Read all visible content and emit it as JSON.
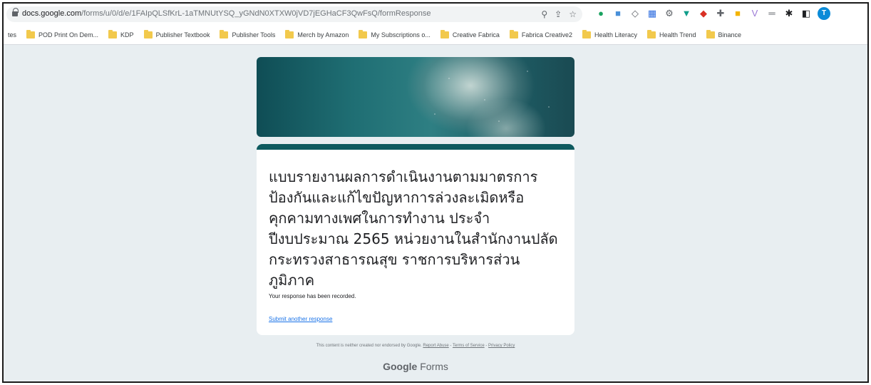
{
  "browser": {
    "url_host": "docs.google.com",
    "url_path": "/forms/u/0/d/e/1FAIpQLSfKrL-1aTMNUtYSQ_yGNdN0XTXW0jVD7jEGHaCF3QwFsQ/formResponse",
    "omnibox_icons": [
      "search-icon",
      "share-icon",
      "star-icon"
    ],
    "extensions": [
      {
        "name": "extension-green-icon",
        "glyph": "●",
        "color": "#1aa260"
      },
      {
        "name": "extension-blue-icon",
        "glyph": "■",
        "color": "#4a90d9"
      },
      {
        "name": "extension-diamond-icon",
        "glyph": "◇",
        "color": "#5f6368"
      },
      {
        "name": "extension-chart-icon",
        "glyph": "▦",
        "color": "#2d6cdf"
      },
      {
        "name": "extension-puzzle-icon",
        "glyph": "⚙",
        "color": "#5f6368"
      },
      {
        "name": "extension-funnel-icon",
        "glyph": "▼",
        "color": "#0f9d8a"
      },
      {
        "name": "extension-colorful-icon",
        "glyph": "◆",
        "color": "#d93025"
      },
      {
        "name": "extension-grid-icon",
        "glyph": "✚",
        "color": "#5f6368"
      },
      {
        "name": "extension-yellow-icon",
        "glyph": "■",
        "color": "#f4b400"
      },
      {
        "name": "extension-v-icon",
        "glyph": "V",
        "color": "#9c7ad6"
      },
      {
        "name": "extension-dash-icon",
        "glyph": "═",
        "color": "#5f6368"
      },
      {
        "name": "extensions-puzzle-icon",
        "glyph": "✱",
        "color": "#202124"
      },
      {
        "name": "side-panel-icon",
        "glyph": "◧",
        "color": "#202124"
      }
    ],
    "avatar_letter": "T"
  },
  "bookmarks": [
    {
      "label": "tes",
      "folder": false
    },
    {
      "label": "POD Print On Dem...",
      "folder": true
    },
    {
      "label": "KDP",
      "folder": true
    },
    {
      "label": "Publisher Textbook",
      "folder": true
    },
    {
      "label": "Publisher Tools",
      "folder": true
    },
    {
      "label": "Merch by Amazon",
      "folder": true
    },
    {
      "label": "My Subscriptions o...",
      "folder": true
    },
    {
      "label": "Creative Fabrica",
      "folder": true
    },
    {
      "label": "Fabrica Creative2",
      "folder": true
    },
    {
      "label": "Health Literacy",
      "folder": true
    },
    {
      "label": "Health Trend",
      "folder": true
    },
    {
      "label": "Binance",
      "folder": true
    }
  ],
  "form": {
    "title": "แบบรายงานผลการดำเนินงานตามมาตรการป้องกันและแก้ไขปัญหาการล่วงละเมิดหรือคุกคามทางเพศในการทำงาน ประจำปีงบประมาณ 2565 หน่วยงานในสำนักงานปลัดกระทรวงสาธารณสุข ราชการบริหารส่วนภูมิภาค",
    "confirmation": "Your response has been recorded.",
    "submit_another": "Submit another response",
    "accent_color": "#0e5a5f"
  },
  "footer": {
    "note": "This content is neither created nor endorsed by Google.",
    "report_abuse": "Report Abuse",
    "terms": "Terms of Service",
    "privacy": "Privacy Policy",
    "brand_google": "Google",
    "brand_forms": "Forms"
  }
}
